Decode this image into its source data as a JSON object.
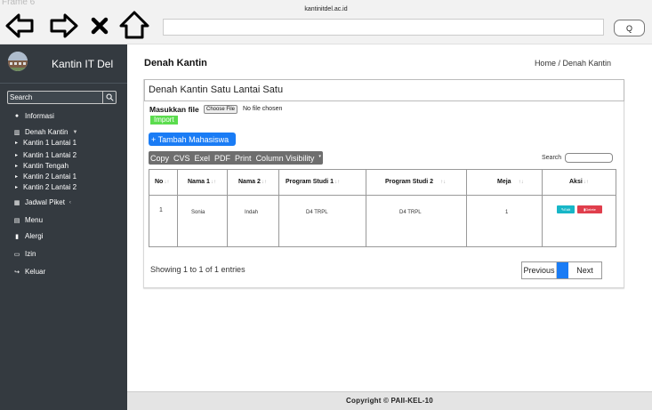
{
  "browser": {
    "frame_label": "Frame 6",
    "url_label": "kantinitdel.ac.id",
    "url_value": "",
    "search_button": "Q"
  },
  "sidebar": {
    "brand": "Kantin IT Del",
    "search_placeholder": "Search",
    "items": [
      {
        "label": "Informasi",
        "icon": "info-circle-icon"
      },
      {
        "label": "Denah Kantin",
        "icon": "map-icon"
      },
      {
        "label": "Jadwal Piket",
        "icon": "calendar-icon"
      },
      {
        "label": "Menu",
        "icon": "menu-icon"
      },
      {
        "label": "Alergi",
        "icon": "allergy-icon"
      },
      {
        "label": "Izin",
        "icon": "chat-icon"
      },
      {
        "label": "Keluar",
        "icon": "logout-icon"
      }
    ],
    "sub_items": [
      "Kantin 1 Lantai 1",
      "Kantin 1 Lantai 2",
      "Kantin Tengah",
      "Kantin 2 Lantai 1",
      "Kantin 2 Lantai 2"
    ]
  },
  "page": {
    "title": "Denah Kantin",
    "breadcrumb": "Home / Denah Kantin"
  },
  "card": {
    "title": "Denah Kantin Satu Lantai Satu",
    "file_label": "Masukkan file",
    "file_button": "Choose File",
    "file_status": "No file chosen",
    "import_button": "Import",
    "add_button": "+ Tambah Mahasiswa",
    "export_buttons": [
      "Copy",
      "CVS",
      "Exel",
      "PDF",
      "Print",
      "Column Visibility"
    ],
    "search_label": "Search"
  },
  "table": {
    "headers": [
      "No",
      "Nama 1",
      "Nama 2",
      "Program Studi 1",
      "Program Studi 2",
      "Meja",
      "Aksi"
    ],
    "rows": [
      [
        "1",
        "Sonia",
        "Indah",
        "D4 TRPL",
        "D4 TRPL",
        "1"
      ]
    ],
    "edit_label": "Edit",
    "delete_label": "Delete"
  },
  "pagination": {
    "info": "Showing 1 to 1 of 1 entries",
    "previous": "Previous",
    "current": "1",
    "next": "Next"
  },
  "footer": {
    "text": "Copyright © PAII-KEL-10"
  },
  "colors": {
    "sidebar_bg": "#343a40",
    "primary": "#1a7cf5",
    "import_green": "#5bdc4e",
    "edit_cyan": "#17b6c7",
    "delete_red": "#e03e4c"
  }
}
